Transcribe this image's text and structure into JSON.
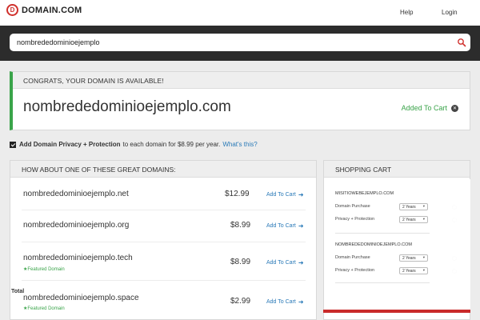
{
  "header": {
    "logo_mark": "D",
    "logo_text": "DOMAIN.COM",
    "help": "Help",
    "login": "Login"
  },
  "search": {
    "value": "nombrededominioejemplo",
    "icon": "search-icon"
  },
  "availability": {
    "heading": "CONGRATS, YOUR DOMAIN IS AVAILABLE!",
    "domain": "nombrededominioejemplo.com",
    "status": "Added To Cart",
    "remove_icon": "close-icon"
  },
  "privacy": {
    "checked": true,
    "bold": "Add Domain Privacy + Protection",
    "text": "to each domain for $8.99 per year.",
    "link": "What's this?"
  },
  "suggestions": {
    "heading": "HOW ABOUT ONE OF THESE GREAT DOMAINS:",
    "items": [
      {
        "domain": "nombrededominioejemplo.net",
        "price": "$12.99",
        "cta": "Add To Cart",
        "featured": ""
      },
      {
        "domain": "nombrededominioejemplo.org",
        "price": "$8.99",
        "cta": "Add To Cart",
        "featured": ""
      },
      {
        "domain": "nombrededominioejemplo.tech",
        "price": "$8.99",
        "cta": "Add To Cart",
        "featured": "Featured Domain"
      },
      {
        "domain": "nombrededominioejemplo.space",
        "price": "$2.99",
        "cta": "Add To Cart",
        "featured": "Featured Domain"
      }
    ]
  },
  "cart": {
    "heading": "SHOPPING CART",
    "items": [
      {
        "title": "MISITIOWEBEJEMPLO.COM",
        "purchase_label": "Domain Purchase",
        "purchase_term": "2 Years",
        "privacy_label": "Privacy + Protection",
        "privacy_term": "2 Years"
      },
      {
        "title": "NOMBREDEDOMINIOEJEMPLO.COM",
        "purchase_label": "Domain Purchase",
        "purchase_term": "2 Years",
        "privacy_label": "Privacy + Protection",
        "privacy_term": "2 Years"
      }
    ],
    "total_label": "Total"
  },
  "colors": {
    "accent_green": "#3aa44a",
    "link_blue": "#2a7ab8",
    "brand_red": "#d0312d",
    "dark_band": "#2c2c2c"
  }
}
